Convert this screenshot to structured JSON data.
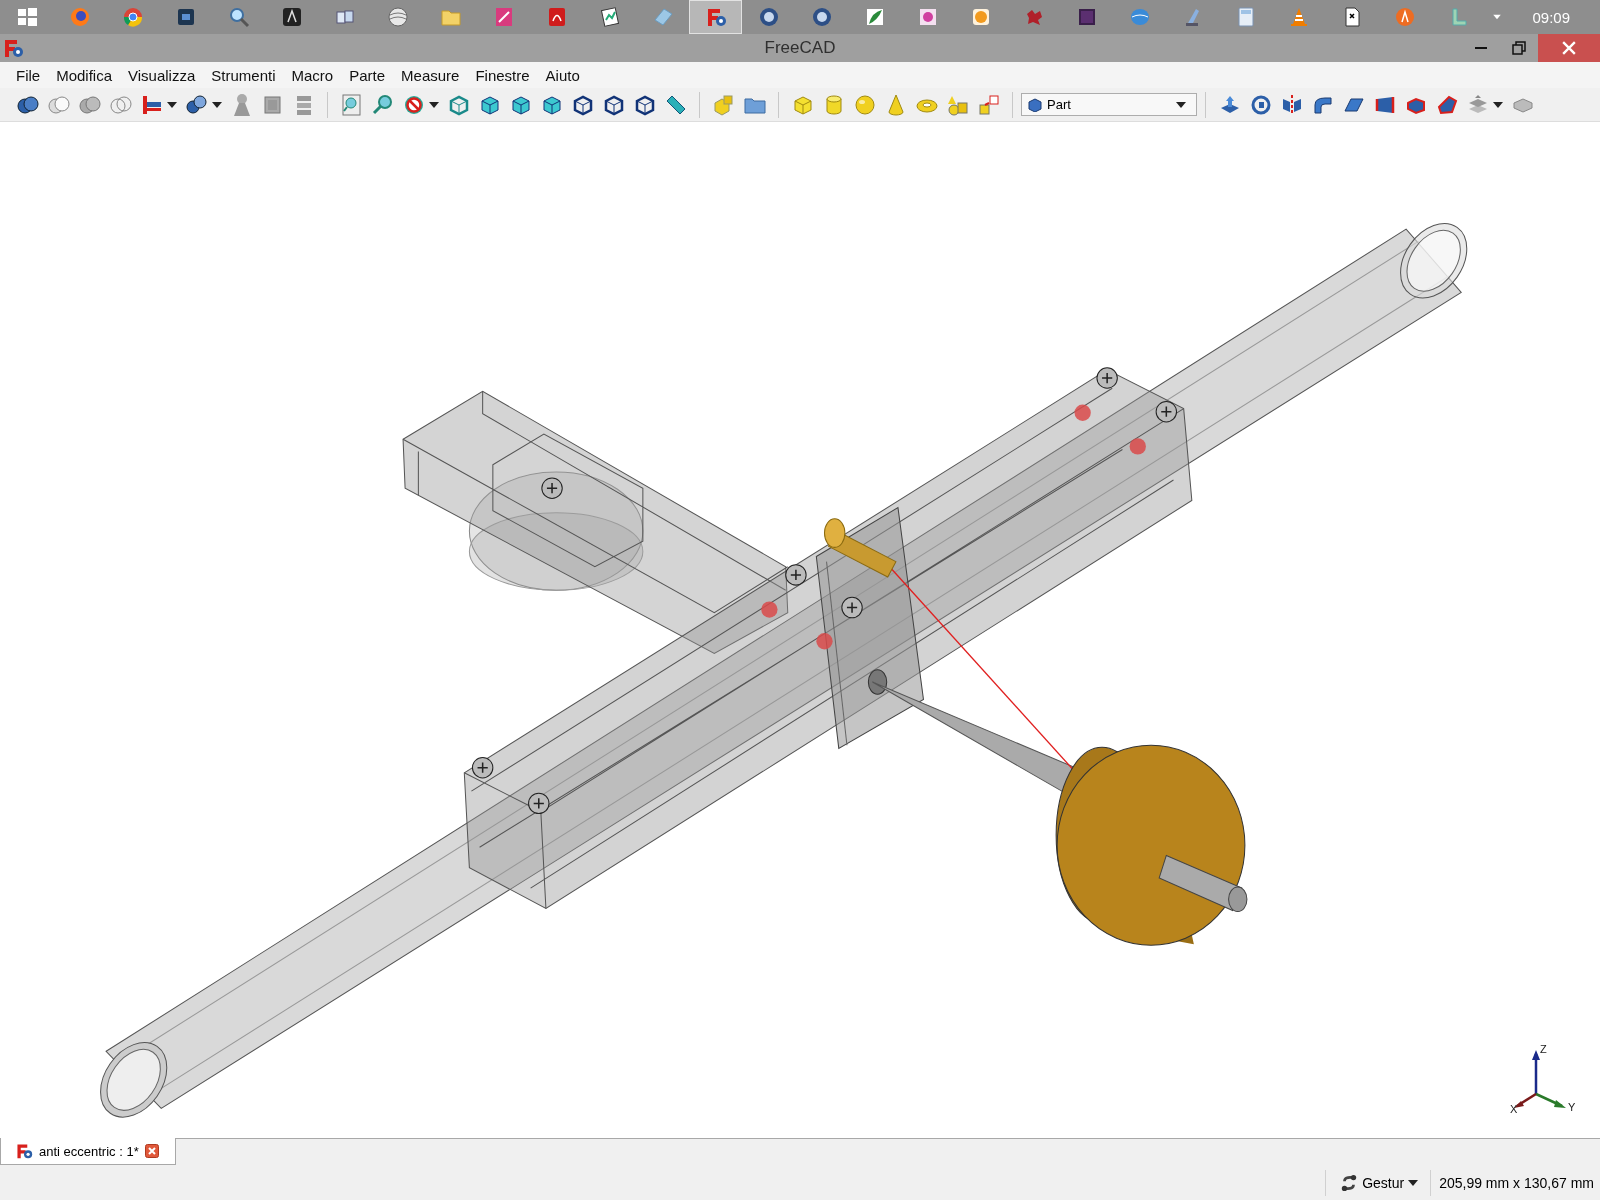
{
  "taskbar": {
    "items": [
      {
        "kind": "windows",
        "selected": false
      },
      {
        "kind": "firefox",
        "selected": false
      },
      {
        "kind": "chrome",
        "selected": false
      },
      {
        "kind": "darkbox",
        "selected": false
      },
      {
        "kind": "magnifier",
        "selected": false
      },
      {
        "kind": "letter",
        "selected": false
      },
      {
        "kind": "cards",
        "selected": false
      },
      {
        "kind": "globe",
        "selected": false
      },
      {
        "kind": "folder",
        "selected": false
      },
      {
        "kind": "pinkdoc",
        "selected": false
      },
      {
        "kind": "pdf",
        "selected": false
      },
      {
        "kind": "chart",
        "selected": false
      },
      {
        "kind": "block",
        "selected": false
      },
      {
        "kind": "freecad",
        "selected": true
      },
      {
        "kind": "bluedisc",
        "selected": false
      },
      {
        "kind": "bluedisc",
        "selected": false
      },
      {
        "kind": "feather",
        "selected": false
      },
      {
        "kind": "flower",
        "selected": false
      },
      {
        "kind": "sun",
        "selected": false
      },
      {
        "kind": "splat",
        "selected": false
      },
      {
        "kind": "purplebox",
        "selected": false
      },
      {
        "kind": "bird",
        "selected": false
      },
      {
        "kind": "scanner",
        "selected": false
      },
      {
        "kind": "calculator",
        "selected": false
      },
      {
        "kind": "cone",
        "selected": false
      },
      {
        "kind": "doc",
        "selected": false
      },
      {
        "kind": "orangedisc",
        "selected": false
      },
      {
        "kind": "lshape",
        "selected": false
      }
    ],
    "clock": "09:09"
  },
  "window": {
    "title": "FreeCAD"
  },
  "menu": [
    "File",
    "Modifica",
    "Visualizza",
    "Strumenti",
    "Macro",
    "Parte",
    "Measure",
    "Finestre",
    "Aiuto"
  ],
  "toolbar": {
    "workbench": "Part"
  },
  "viewport": {
    "axis_labels": [
      {
        "kind": "z",
        "text": "Z"
      },
      {
        "kind": "y",
        "text": "Y"
      },
      {
        "kind": "x",
        "text": "X"
      }
    ]
  },
  "tabs": [
    {
      "label": "anti eccentric : 1*",
      "selected": true
    }
  ],
  "status_bar": {
    "navigation": "Gestur",
    "dimensions": "205,99 mm x 130,67 mm"
  }
}
